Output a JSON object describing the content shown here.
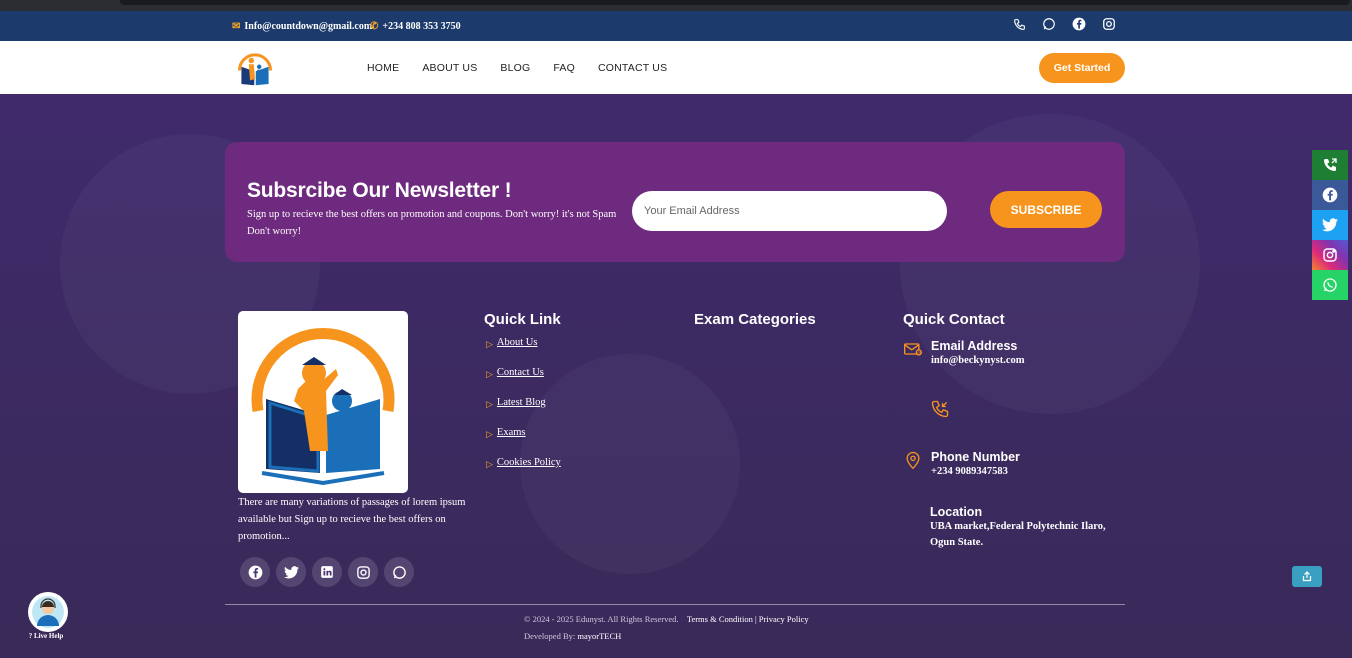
{
  "topbar": {
    "email": "Info@countdown@gmail.com",
    "phone": "+234 808 353 3750",
    "social_icons": [
      "phone-icon",
      "whatsapp-icon",
      "facebook-icon",
      "instagram-icon"
    ]
  },
  "nav": {
    "items": [
      "HOME",
      "ABOUT US",
      "BLOG",
      "FAQ",
      "CONTACT US"
    ],
    "cta_label": "Get Started"
  },
  "newsletter": {
    "title": "Subsrcibe Our Newsletter !",
    "subtitle": "Sign up to recieve the best offers on promotion and coupons. Don't worry! it's not Spam Don't worry!",
    "email_placeholder": "Your Email Address",
    "button_label": "SUBSCRIBE"
  },
  "side_social": [
    {
      "icon": "phone-call-icon",
      "color": "#1e7e34"
    },
    {
      "icon": "facebook-icon",
      "color": "#3b5998"
    },
    {
      "icon": "twitter-icon",
      "color": "#1da1f2"
    },
    {
      "icon": "instagram-icon",
      "color": "#c13584"
    },
    {
      "icon": "whatsapp-icon",
      "color": "#25d366"
    }
  ],
  "footer": {
    "about_text": "There are many variations of passages of lorem ipsum available but Sign up to recieve the best offers on promotion...",
    "social_icons": [
      "facebook-icon",
      "twitter-icon",
      "linkedin-icon",
      "instagram-icon",
      "whatsapp-icon"
    ],
    "quick_link_title": "Quick Link",
    "quick_links": [
      "About Us",
      "Contact Us",
      "Latest Blog",
      "Exams",
      "Cookies Policy"
    ],
    "exam_categories_title": "Exam Categories",
    "quick_contact_title": "Quick Contact",
    "contact": {
      "email_label": "Email Address",
      "email_value": "info@beckynyst.com",
      "phone_label": "Phone Number",
      "phone_value": "+234 9089347583",
      "location_label": "Location",
      "location_value": "UBA market,Federal Polytechnic Ilaro, Ogun State."
    },
    "copyright": "© 2024 - 2025 Edunyst. All Rights Reserved.",
    "terms_link": "Terms & Condition | Privacy Policy",
    "developed_by_label": "Developed By:",
    "developer": "mayorTECH"
  },
  "live_help_label": "? Live Help",
  "colors": {
    "accent": "#f7941d",
    "topbar": "#1c3a6b",
    "newsletter_bg": "#6d2a7e",
    "hero_bg": "#402a6c"
  }
}
